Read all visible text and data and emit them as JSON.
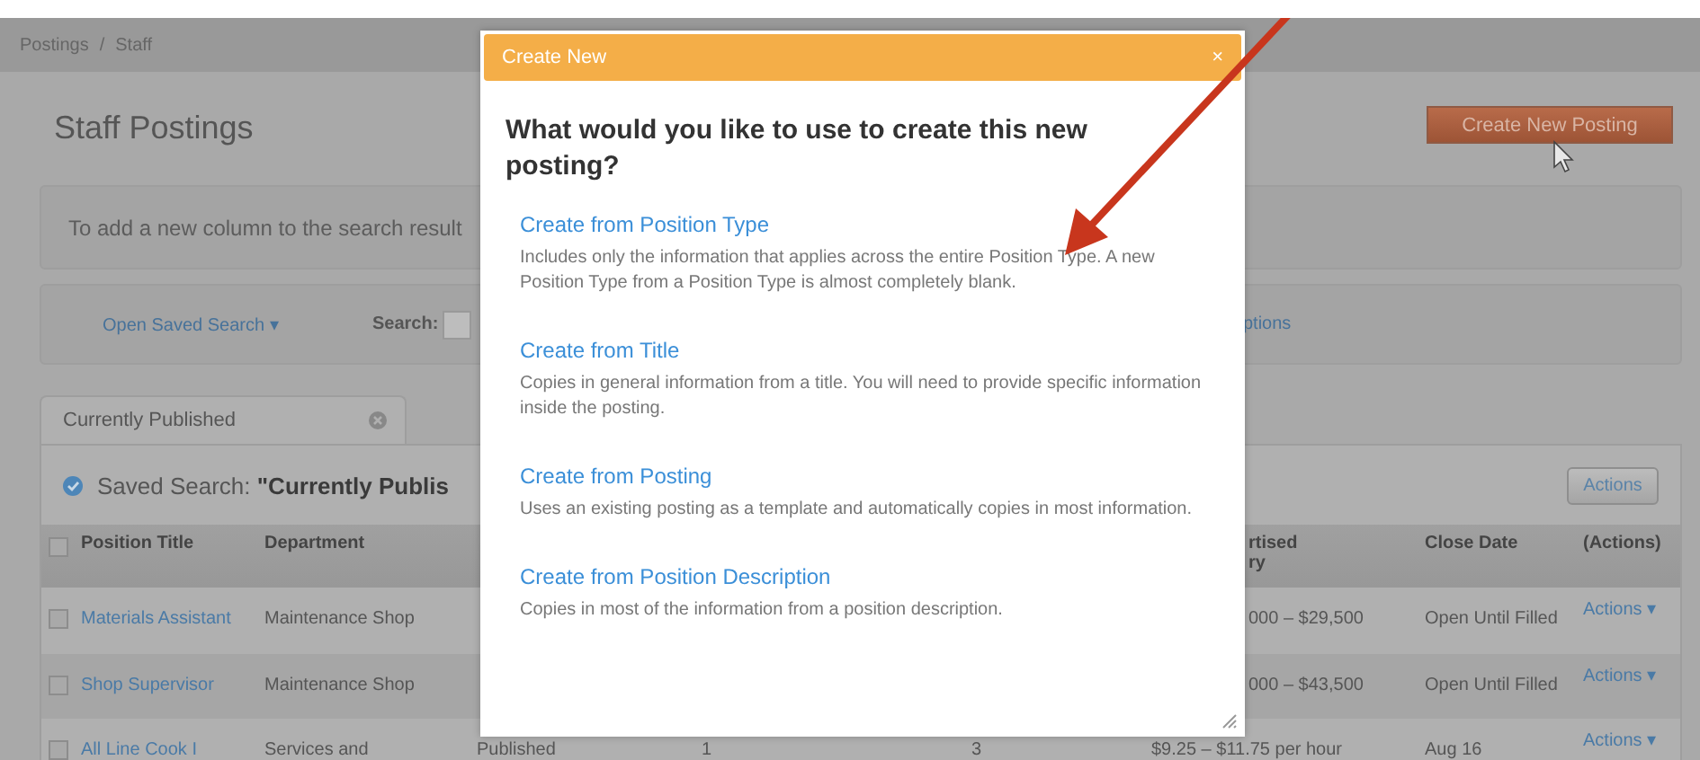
{
  "breadcrumb": {
    "items": [
      "Postings",
      "Staff"
    ],
    "separator": "/"
  },
  "page_title": "Staff Postings",
  "create_button": "Create New Posting",
  "info_text": "To add a new column to the search result",
  "search_bar": {
    "saved_search_link": "Open Saved Search ▾",
    "search_label": "Search:",
    "options_link": "ptions"
  },
  "tabs": [
    {
      "label": "Currently Published",
      "selected": true
    }
  ],
  "saved_search": {
    "label": "Saved Search:",
    "name": "\"Currently Publis"
  },
  "actions_button": "Actions",
  "table": {
    "header": {
      "checked": false,
      "position_title": "Position Title",
      "department": "Department",
      "salary": [
        "rtised",
        "ry"
      ],
      "close_date": "Close Date",
      "actions": "(Actions)"
    },
    "rows": [
      {
        "checked": false,
        "position_title": "Materials Assistant",
        "department": "Maintenance Shop",
        "salary": "000 – $29,500",
        "close_date": "Open Until Filled",
        "actions": "Actions ▾"
      },
      {
        "checked": false,
        "position_title": "Shop Supervisor",
        "department": "Maintenance Shop",
        "salary": "000 – $43,500",
        "close_date": "Open Until Filled",
        "actions": "Actions ▾"
      },
      {
        "checked": false,
        "position_title": "All Line Cook I",
        "department": "Services and",
        "column_4": "Published",
        "column_5": "1",
        "column_6": "3",
        "salary": "$9.25 – $11.75 per hour",
        "close_date": "Aug 16",
        "actions": "Actions ▾"
      }
    ]
  },
  "dialog": {
    "title": "Create New",
    "close": "×",
    "question": "What would you like to use to create this new posting?",
    "options": [
      {
        "title": "Create from Position Type",
        "description": "Includes only the information that applies across the entire Position Type. A new Position Type from a Position Type is almost completely blank."
      },
      {
        "title": "Create from Title",
        "description": "Copies in general information from a title. You will need to provide specific information inside the posting."
      },
      {
        "title": "Create from Posting",
        "description": "Uses an existing posting as a template and automatically copies in most information."
      },
      {
        "title": "Create from Position Description",
        "description": "Copies in most of the information from a position description."
      }
    ]
  }
}
